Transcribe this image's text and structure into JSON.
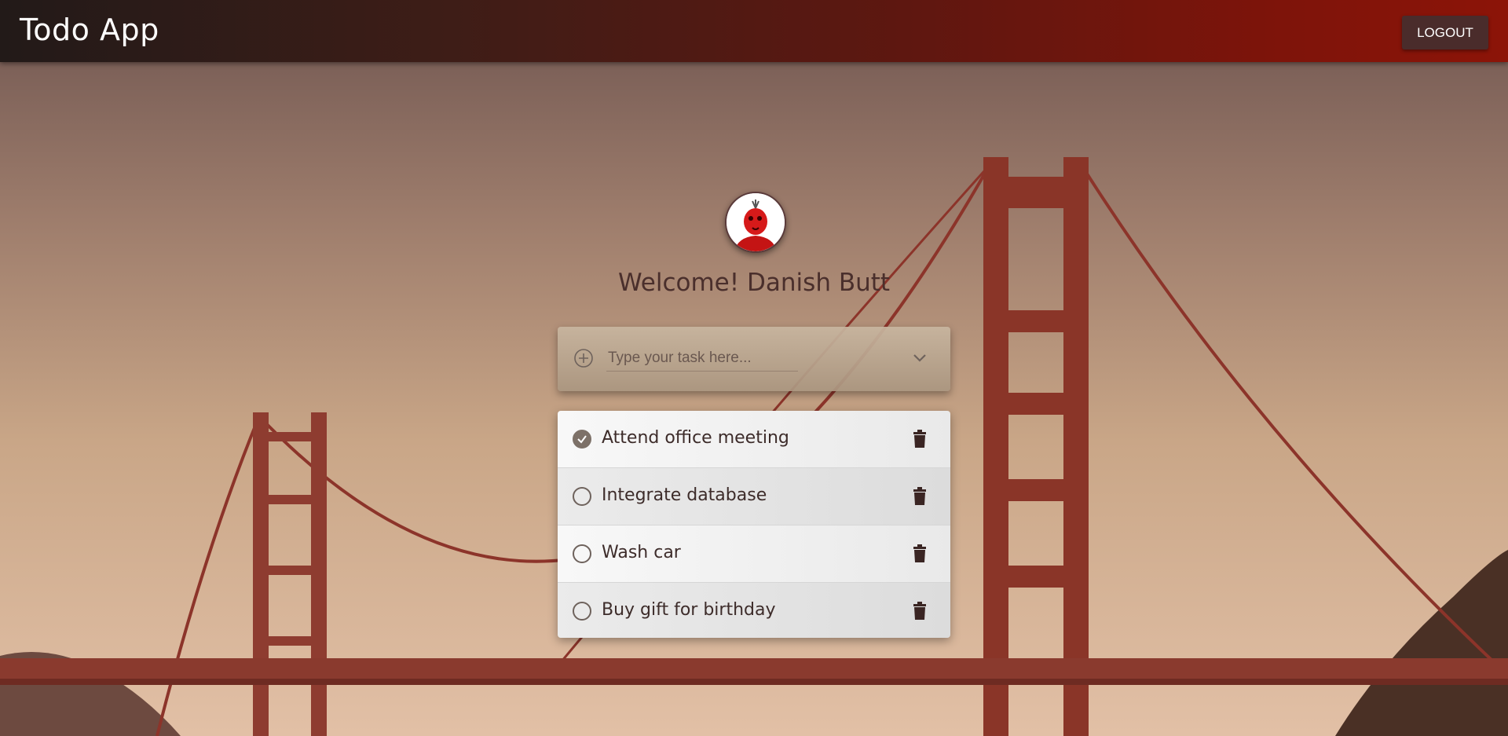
{
  "app": {
    "title": "Todo App",
    "logout_label": "LOGOUT"
  },
  "user": {
    "welcome": "Welcome! Danish Butt",
    "avatar": "user-avatar-icon"
  },
  "task_input": {
    "placeholder": "Type your task here...",
    "add_icon": "plus-circle-icon",
    "expand_icon": "chevron-down-icon"
  },
  "tasks": [
    {
      "label": "Attend office meeting",
      "done": true
    },
    {
      "label": "Integrate database",
      "done": false
    },
    {
      "label": "Wash car",
      "done": false
    },
    {
      "label": "Buy gift for birthday",
      "done": false
    }
  ],
  "colors": {
    "header_start": "#221a18",
    "header_end": "#8c1408",
    "logout_bg": "#4a2c2b",
    "bridge": "#9c3a2e"
  }
}
